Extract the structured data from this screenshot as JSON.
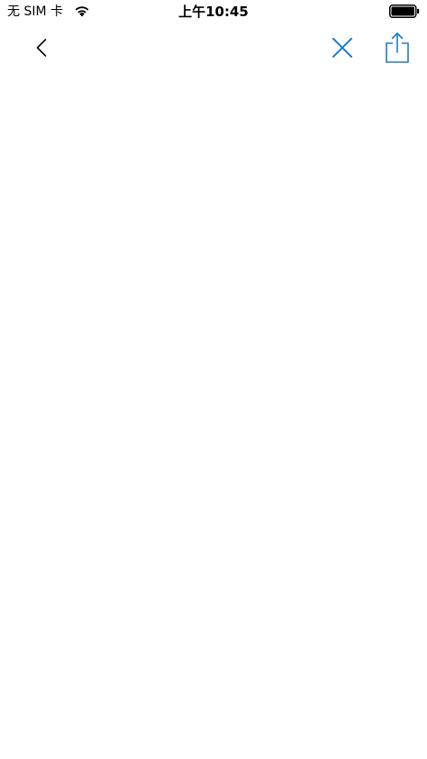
{
  "status_bar": {
    "carrier": "无 SIM 卡",
    "time": "上午10:45",
    "icons": [
      "wifi-icon",
      "battery-icon"
    ]
  },
  "nav_bar": {
    "icons": [
      "chevron-left-icon",
      "close-icon",
      "share-icon"
    ],
    "colors": {
      "back": "#000000",
      "accent": "#1a7ad4"
    }
  }
}
